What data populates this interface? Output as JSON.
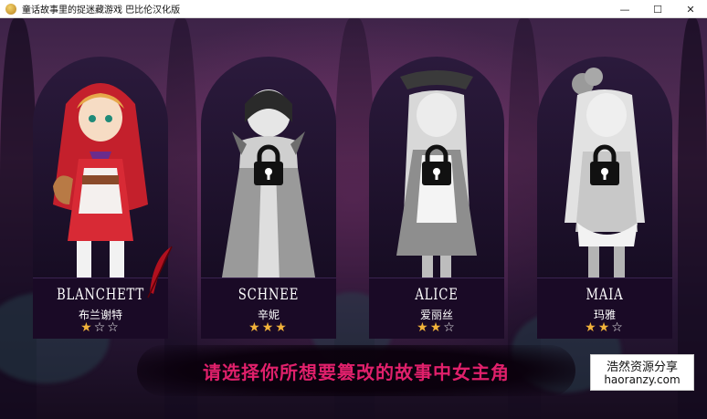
{
  "window": {
    "title": "童话故事里的捉迷藏游戏 巴比伦汉化版",
    "controls": {
      "minimize": "—",
      "maximize": "☐",
      "close": "✕"
    }
  },
  "characters": [
    {
      "name_en": "BLANCHETT",
      "name_cn": "布兰谢特",
      "rating": 1,
      "max_rating": 3,
      "locked": false,
      "stars": "★☆☆"
    },
    {
      "name_en": "SCHNEE",
      "name_cn": "辛妮",
      "rating": 3,
      "max_rating": 3,
      "locked": true,
      "stars": "★★★"
    },
    {
      "name_en": "ALICE",
      "name_cn": "爱丽丝",
      "rating": 2,
      "max_rating": 3,
      "locked": true,
      "stars": "★★☆"
    },
    {
      "name_en": "MAIA",
      "name_cn": "玛雅",
      "rating": 2,
      "max_rating": 3,
      "locked": true,
      "stars": "★★☆"
    }
  ],
  "instruction": "请选择你所想要篡改的故事中女主角",
  "watermark": {
    "line1": "浩然资源分享",
    "line2": "haoranzy.com"
  },
  "colors": {
    "accent": "#e0206b",
    "star_on": "#f2b33a",
    "plate": "#1a0a26",
    "red_hood": "#c4202c"
  },
  "icons": {
    "lock": "lock-icon",
    "star": "star-icon",
    "feather": "quill-feather-icon"
  }
}
